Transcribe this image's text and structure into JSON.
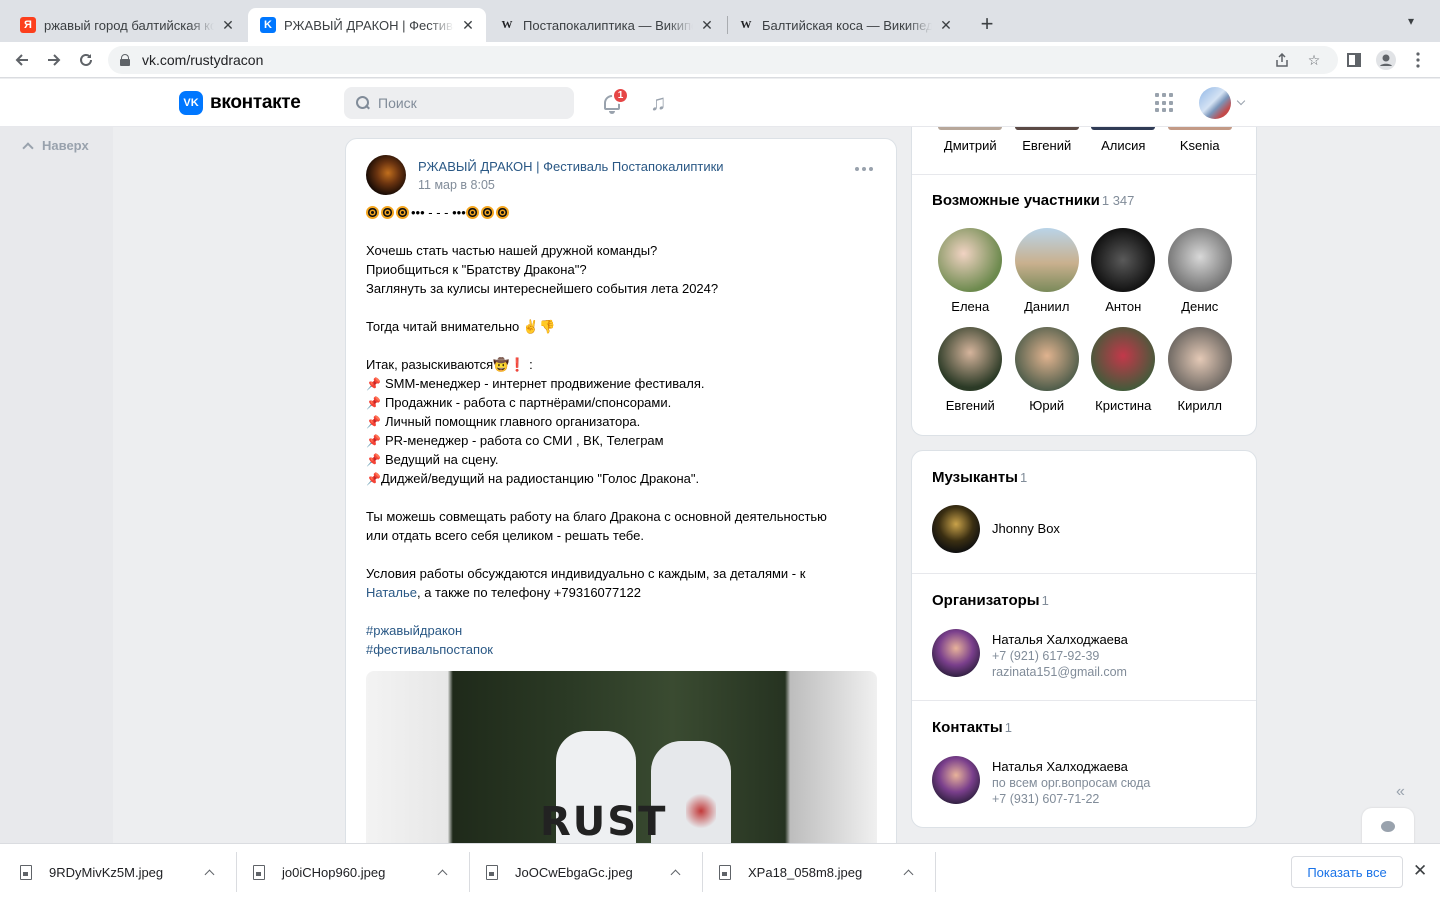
{
  "browser": {
    "tabs": [
      {
        "title": "ржавый город балтийская коса",
        "favicon": "yandex-icon"
      },
      {
        "title": "РЖАВЫЙ ДРАКОН | Фестиваль Постапокалиптики",
        "favicon": "vk-icon",
        "active": true
      },
      {
        "title": "Постапокалиптика — Википедия",
        "favicon": "wikipedia-icon"
      },
      {
        "title": "Балтийская коса — Википедия",
        "favicon": "wikipedia-icon"
      }
    ],
    "tab_close_glyph": "✕",
    "new_tab_glyph": "+",
    "url": "vk.com/rustydracon"
  },
  "vk": {
    "logo_text": "вконтакте",
    "logo_mark": "VK",
    "search_placeholder": "Поиск",
    "notifications_count": "1",
    "scroll_top_label": "Наверх"
  },
  "post": {
    "author": "РЖАВЫЙ ДРАКОН | Фестиваль Постапокалиптики",
    "date": "11 мар в 8:05",
    "header_line_mid": "••• - - - •••",
    "lines": [
      "Хочешь стать частью нашей дружной команды?",
      "Приобщиться к \"Братству Дракона\"?",
      "Заглянуть за кулисы интереснейшего события лета 2024?",
      "Тогда читай внимательно ✌️👎",
      "Итак, разыскиваются🤠❗ :"
    ],
    "vacancies": [
      "SMM-менеджер - интернет продвижение фестиваля.",
      "Продажник - работа с партнёрами/спонсорами.",
      "Личный помощник главного организатора.",
      "PR-менеджер - работа со СМИ , ВК, Телеграм",
      "Ведущий на сцену.",
      "Диджей/ведущий на радиостанцию \"Голос Дракона\"."
    ],
    "combine_1": "Ты можешь совмещать работу на благо Дракона с основной деятельностью",
    "combine_2": "или отдать всего себя целиком - решать тебе.",
    "conditions_1": "Условия работы обсуждаются индивидуально с каждым, за деталями - к",
    "conditions_link": "Наталье",
    "conditions_2": ", а также по телефону +79316077122",
    "hashtags": [
      "#ржавыйдракон",
      "#фестивальпостапок"
    ],
    "photo_text": "RUST"
  },
  "friends_top": [
    "Дмитрий",
    "Евгений",
    "Алисия",
    "Ksenia"
  ],
  "possible_members": {
    "title": "Возможные участники",
    "count": "1 347",
    "people": [
      "Елена",
      "Даниил",
      "Антон",
      "Денис",
      "Евгений",
      "Юрий",
      "Кристина",
      "Кирилл"
    ]
  },
  "musicians": {
    "title": "Музыканты",
    "count": "1",
    "name": "Jhonny Box"
  },
  "organizers": {
    "title": "Организаторы",
    "count": "1",
    "name": "Наталья Халходжаева",
    "phone": "+7 (921) 617-92-39",
    "email": "razinata151@gmail.com"
  },
  "contacts": {
    "title": "Контакты",
    "count": "1",
    "name": "Наталья Халходжаева",
    "note": "по всем орг.вопросам сюда",
    "phone": "+7 (931) 607-71-22"
  },
  "downloads": {
    "files": [
      "9RDyMivKz5M.jpeg",
      "jo0iCHop960.jpeg",
      "JoOCwEbgaGc.jpeg",
      "XPa18_058m8.jpeg"
    ],
    "show_all": "Показать все"
  },
  "colors": {
    "vk_blue": "#0077ff",
    "link": "#2a5885",
    "muted": "#818c99",
    "badge": "#e64646"
  }
}
